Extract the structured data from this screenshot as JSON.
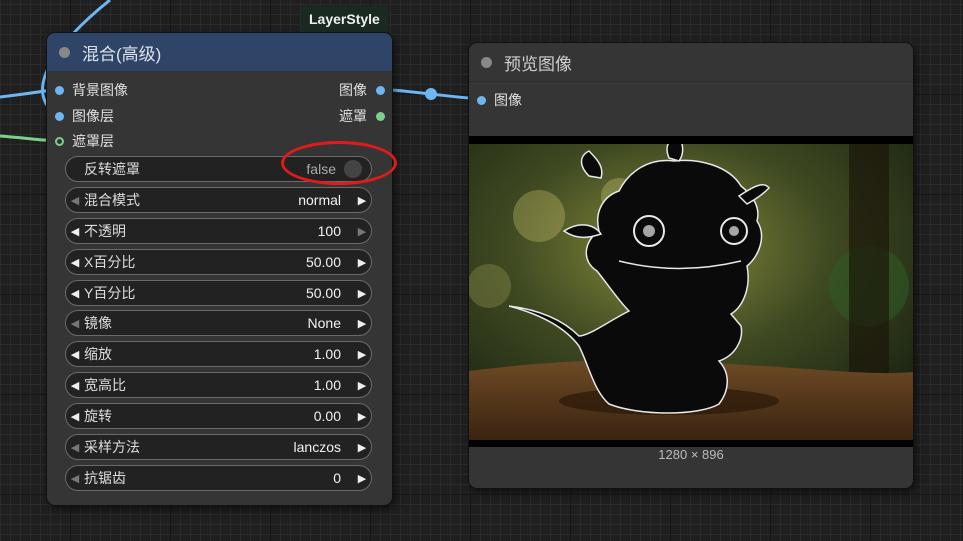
{
  "badge": {
    "label": "LayerStyle"
  },
  "blend_node": {
    "title": "混合(高级)",
    "inputs": [
      {
        "label": "背景图像",
        "type": "image"
      },
      {
        "label": "图像层",
        "type": "image"
      },
      {
        "label": "遮罩层",
        "type": "mask"
      }
    ],
    "outputs": [
      {
        "label": "图像",
        "type": "image"
      },
      {
        "label": "遮罩",
        "type": "mask"
      }
    ],
    "toggle": {
      "label": "反转遮罩",
      "value": "false"
    },
    "widgets": [
      {
        "label": "混合模式",
        "value": "normal"
      },
      {
        "label": "不透明",
        "value": "100"
      },
      {
        "label": "X百分比",
        "value": "50.00"
      },
      {
        "label": "Y百分比",
        "value": "50.00"
      },
      {
        "label": "镜像",
        "value": "None"
      },
      {
        "label": "缩放",
        "value": "1.00"
      },
      {
        "label": "宽高比",
        "value": "1.00"
      },
      {
        "label": "旋转",
        "value": "0.00"
      },
      {
        "label": "采样方法",
        "value": "lanczos"
      },
      {
        "label": "抗锯齿",
        "value": "0"
      }
    ]
  },
  "preview_node": {
    "title": "预览图像",
    "input": {
      "label": "图像",
      "type": "image"
    },
    "resolution": "1280 × 896"
  },
  "colors": {
    "image_link": "#6eb6f2",
    "mask_link": "#7dd08a",
    "blend_header": "#2f4568",
    "highlight": "#e01b1b"
  }
}
